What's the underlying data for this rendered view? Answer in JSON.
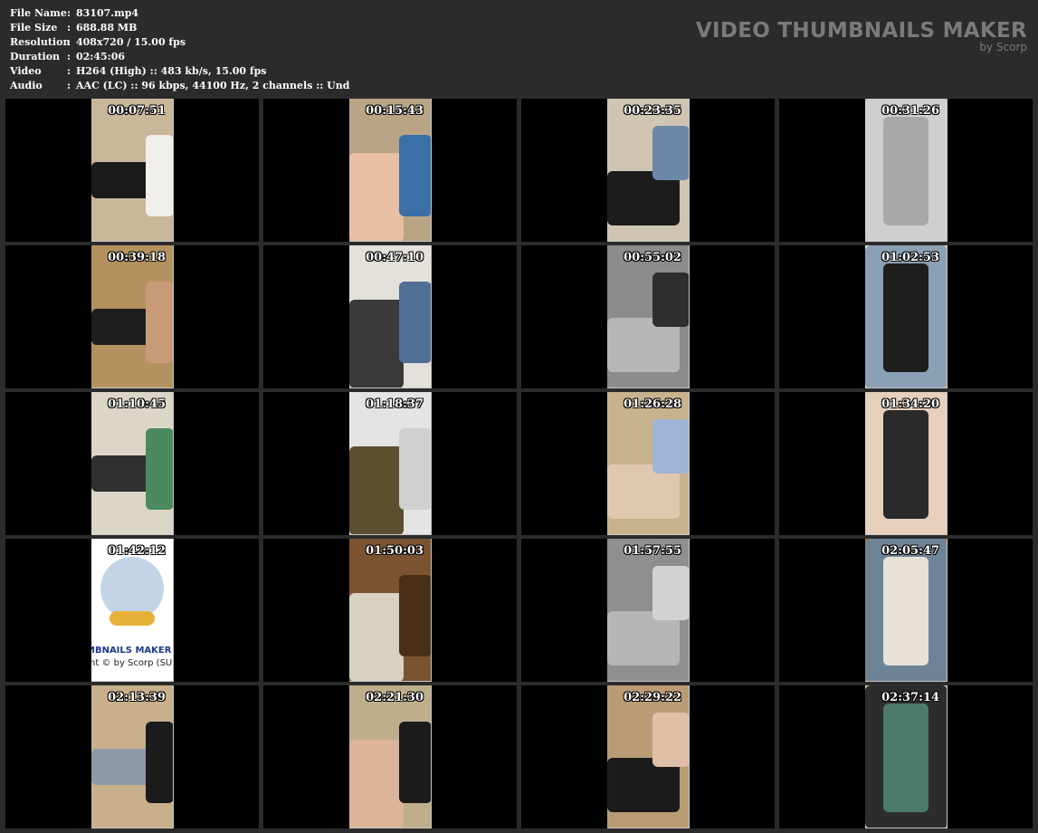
{
  "info": [
    {
      "label": "File Name",
      "value": "83107.mp4"
    },
    {
      "label": "File Size",
      "value": "688.88 MB"
    },
    {
      "label": "Resolution",
      "value": "408x720 / 15.00 fps"
    },
    {
      "label": "Duration",
      "value": "02:45:06"
    },
    {
      "label": "Video",
      "value": "H264 (High) :: 483 kb/s, 15.00 fps"
    },
    {
      "label": "Audio",
      "value": "AAC (LC) :: 96 kbps, 44100 Hz, 2 channels :: Und"
    }
  ],
  "separator": ":",
  "brand": {
    "title": "VIDEO THUMBNAILS MAKER",
    "subtitle": "by Scorp"
  },
  "thumbnails": [
    {
      "time": "00:07:51",
      "bg": "#c9b79a",
      "accent": "#1a1a1a",
      "accent2": "#f1efe9"
    },
    {
      "time": "00:15:43",
      "bg": "#b9a585",
      "accent": "#e8bfa2",
      "accent2": "#3b6fa8"
    },
    {
      "time": "00:23:35",
      "bg": "#cfc5b2",
      "accent": "#1c1c1c",
      "accent2": "#6c87a8"
    },
    {
      "time": "00:31:26",
      "bg": "#bdbdbd",
      "accent": "#cfcfcf",
      "accent2": "#a8a8a8"
    },
    {
      "time": "00:39:18",
      "bg": "#b3925f",
      "accent": "#1e1e1e",
      "accent2": "#c79a78"
    },
    {
      "time": "00:47:10",
      "bg": "#e3e1da",
      "accent": "#3a3a3a",
      "accent2": "#4f6f95"
    },
    {
      "time": "00:55:02",
      "bg": "#8c8c8c",
      "accent": "#b7b7b7",
      "accent2": "#2e2e2e"
    },
    {
      "time": "01:02:53",
      "bg": "#e7e4dd",
      "accent": "#8aa0b5",
      "accent2": "#1e1e1e"
    },
    {
      "time": "01:10:45",
      "bg": "#dcd6c9",
      "accent": "#2f2f2f",
      "accent2": "#4b8a5f"
    },
    {
      "time": "01:18:37",
      "bg": "#e4e4e4",
      "accent": "#5c4e2e",
      "accent2": "#d0d0d0"
    },
    {
      "time": "01:26:28",
      "bg": "#c9b28e",
      "accent": "#e0c8b0",
      "accent2": "#9fb5d8"
    },
    {
      "time": "01:34:20",
      "bg": "#cfc7bb",
      "accent": "#e6d0bc",
      "accent2": "#2a2a2a"
    },
    {
      "time": "01:42:12",
      "bg": "#ffffff",
      "accent": "#e8b23a",
      "accent2": "#9bb7d6",
      "logo": true,
      "logo_text": "MBNAILS MAKER",
      "logo_sub": "nt © by Scorp (SU"
    },
    {
      "time": "01:50:03",
      "bg": "#7b5330",
      "accent": "#d8d2c4",
      "accent2": "#4a2f18"
    },
    {
      "time": "01:57:55",
      "bg": "#8f8f8f",
      "accent": "#b6b6b6",
      "accent2": "#d3d3d3"
    },
    {
      "time": "02:05:47",
      "bg": "#a8773f",
      "accent": "#6f8397",
      "accent2": "#e8e2d6"
    },
    {
      "time": "02:13:39",
      "bg": "#c8b08c",
      "accent": "#8d99a6",
      "accent2": "#1b1b1b"
    },
    {
      "time": "02:21:30",
      "bg": "#bfae8c",
      "accent": "#dbb49a",
      "accent2": "#1b1b1b"
    },
    {
      "time": "02:29:22",
      "bg": "#b99c76",
      "accent": "#1b1b1b",
      "accent2": "#e0bfa8"
    },
    {
      "time": "02:37:14",
      "bg": "#d9d4ca",
      "accent": "#2c2c2c",
      "accent2": "#4c7a68"
    }
  ]
}
